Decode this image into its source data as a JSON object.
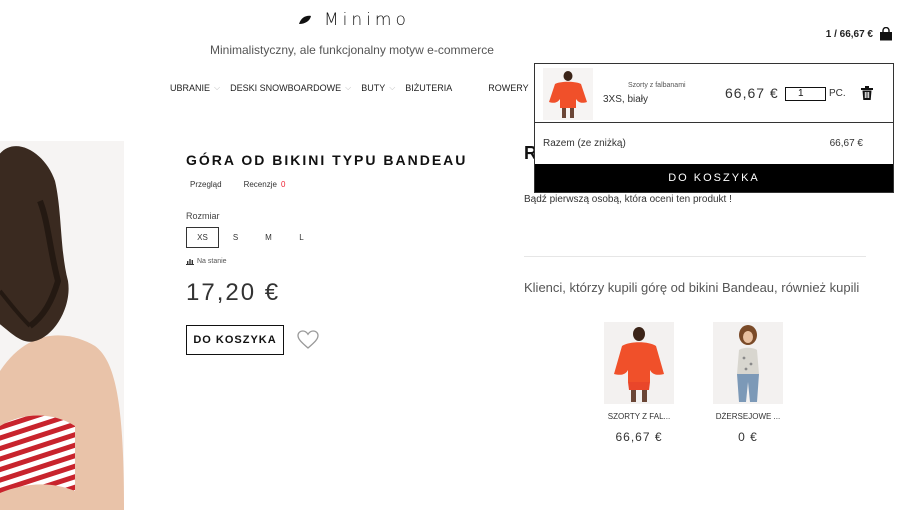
{
  "header": {
    "logo_text": "Minimo",
    "tagline": "Minimalistyczny, ale funkcjonalny motyw e-commerce",
    "cart_summary": "1 / 66,67 €"
  },
  "nav": {
    "items": [
      {
        "label": "UBRANIE",
        "has_dropdown": true
      },
      {
        "label": "DESKI SNOWBOARDOWE",
        "has_dropdown": true
      },
      {
        "label": "BUTY",
        "has_dropdown": true
      },
      {
        "label": "BIŻUTERIA",
        "has_dropdown": false
      },
      {
        "label": "ROWERY",
        "has_dropdown": false
      }
    ]
  },
  "product": {
    "title": "GÓRA OD BIKINI TYPU BANDEAU",
    "tabs": {
      "overview": "Przegląd",
      "reviews": "Recenzje",
      "reviews_count": "0"
    },
    "size_label": "Rozmiar",
    "sizes": [
      "XS",
      "S",
      "M",
      "L"
    ],
    "selected_size": "XS",
    "stock": "Na stanie",
    "price": "17,20 €",
    "add_to_cart": "DO KOSZYKA"
  },
  "reviews": {
    "heading_partial": "R",
    "empty_text": "Bądź pierwszą osobą, która oceni ten produkt !"
  },
  "related": {
    "heading": "Klienci, którzy kupili górę od bikini Bandeau, również kupili",
    "items": [
      {
        "name": "SZORTY Z FAL...",
        "price": "66,67 €"
      },
      {
        "name": "DŻERSEJOWE ...",
        "price": "0 €"
      }
    ]
  },
  "minicart": {
    "item": {
      "name": "Szorty z falbanami",
      "variant": "3XS, biały",
      "price": "66,67 €",
      "qty": "1",
      "unit": "PC."
    },
    "total_label": "Razem (ze zniżką)",
    "total_value": "66,67 €",
    "checkout": "DO KOSZYKA"
  },
  "colors": {
    "accent_red": "#e23333",
    "stripe_red": "#c8242d",
    "orange_product": "#f0502a"
  }
}
